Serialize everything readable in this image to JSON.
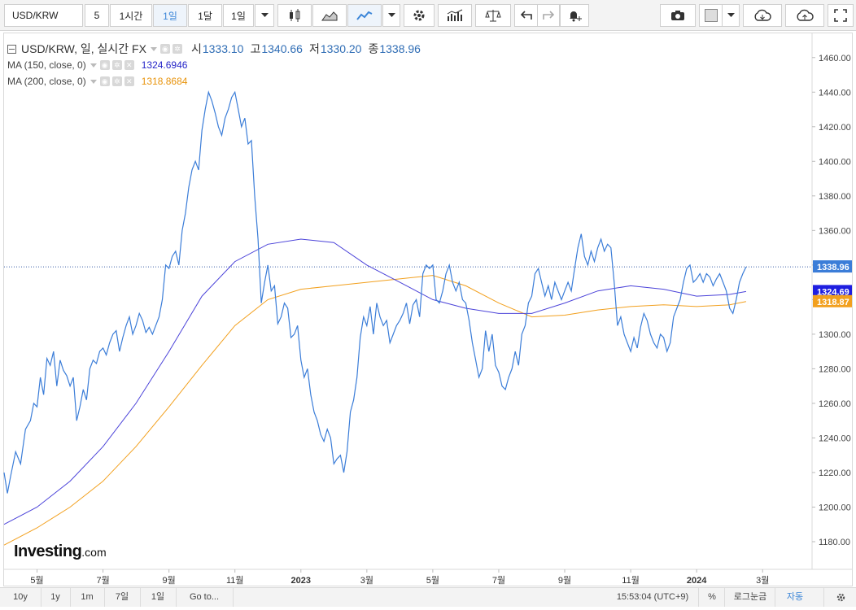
{
  "toolbar": {
    "symbol": "USD/KRW",
    "items": [
      "5",
      "1시간",
      "1일",
      "1달",
      "1일"
    ],
    "active_item": "1일"
  },
  "legend": {
    "title": "USD/KRW, 일, 실시간 FX",
    "open_label": "시",
    "open": "1333.10",
    "high_label": "고",
    "high": "1340.66",
    "low_label": "저",
    "low": "1330.20",
    "close_label": "종",
    "close": "1338.96",
    "ma150_label": "MA (150, close, 0)",
    "ma150_value": "1324.6946",
    "ma200_label": "MA (200, close, 0)",
    "ma200_value": "1318.8684"
  },
  "logo": {
    "name": "Investing",
    "suffix": ".com"
  },
  "bottom": {
    "ranges": [
      "10y",
      "1y",
      "1m",
      "7일",
      "1일",
      "Go to..."
    ],
    "time": "15:53:04 (UTC+9)",
    "percent": "%",
    "log": "로그눈금",
    "auto": "자동"
  },
  "colors": {
    "price": "#3b7dd8",
    "ma150": "#4b43d9",
    "ma200": "#f2a01e",
    "last_price_tag": "#3b7dd8",
    "ma150_tag": "#1e1ee0",
    "ma200_tag": "#f2a01e"
  },
  "chart_data": {
    "type": "line",
    "title": "USD/KRW, 일, 실시간 FX",
    "y_ticks": [
      1180,
      1200,
      1220,
      1240,
      1260,
      1280,
      1300,
      1320,
      1340,
      1360,
      1380,
      1400,
      1420,
      1440,
      1460
    ],
    "ylim": [
      1164,
      1474
    ],
    "x_ticks": [
      "5월",
      "7월",
      "9월",
      "11월",
      "2023",
      "3월",
      "5월",
      "7월",
      "9월",
      "11월",
      "2024",
      "3월"
    ],
    "x_tick_index": [
      1,
      3,
      5,
      7,
      9,
      11,
      13,
      15,
      17,
      19,
      21,
      23
    ],
    "x_range": [
      0,
      24.5
    ],
    "price_tags": [
      {
        "label": "1338.96",
        "value": 1338.96,
        "color": "#3b7dd8"
      },
      {
        "label": "1324.69",
        "value": 1324.69,
        "color": "#1e1ee0"
      },
      {
        "label": "1318.87",
        "value": 1318.87,
        "color": "#f2a01e"
      }
    ],
    "last_price_line": 1338.96,
    "series": [
      {
        "name": "USD/KRW",
        "color": "#3b7dd8",
        "points": [
          [
            0.0,
            1220
          ],
          [
            0.1,
            1208
          ],
          [
            0.2,
            1218
          ],
          [
            0.35,
            1232
          ],
          [
            0.5,
            1225
          ],
          [
            0.65,
            1245
          ],
          [
            0.8,
            1250
          ],
          [
            0.9,
            1260
          ],
          [
            1.0,
            1258
          ],
          [
            1.1,
            1275
          ],
          [
            1.2,
            1265
          ],
          [
            1.3,
            1286
          ],
          [
            1.4,
            1282
          ],
          [
            1.5,
            1290
          ],
          [
            1.6,
            1270
          ],
          [
            1.7,
            1285
          ],
          [
            1.8,
            1279
          ],
          [
            1.9,
            1276
          ],
          [
            2.0,
            1270
          ],
          [
            2.1,
            1275
          ],
          [
            2.2,
            1250
          ],
          [
            2.3,
            1258
          ],
          [
            2.4,
            1268
          ],
          [
            2.5,
            1262
          ],
          [
            2.6,
            1280
          ],
          [
            2.7,
            1285
          ],
          [
            2.8,
            1283
          ],
          [
            2.9,
            1290
          ],
          [
            3.0,
            1292
          ],
          [
            3.1,
            1288
          ],
          [
            3.2,
            1295
          ],
          [
            3.3,
            1300
          ],
          [
            3.4,
            1302
          ],
          [
            3.5,
            1290
          ],
          [
            3.6,
            1298
          ],
          [
            3.7,
            1305
          ],
          [
            3.8,
            1310
          ],
          [
            3.9,
            1300
          ],
          [
            4.0,
            1305
          ],
          [
            4.1,
            1312
          ],
          [
            4.2,
            1308
          ],
          [
            4.3,
            1301
          ],
          [
            4.4,
            1304
          ],
          [
            4.5,
            1300
          ],
          [
            4.6,
            1305
          ],
          [
            4.7,
            1310
          ],
          [
            4.8,
            1320
          ],
          [
            4.9,
            1340
          ],
          [
            5.0,
            1338
          ],
          [
            5.1,
            1345
          ],
          [
            5.2,
            1348
          ],
          [
            5.3,
            1340
          ],
          [
            5.4,
            1360
          ],
          [
            5.5,
            1370
          ],
          [
            5.6,
            1385
          ],
          [
            5.7,
            1395
          ],
          [
            5.8,
            1400
          ],
          [
            5.9,
            1395
          ],
          [
            6.0,
            1418
          ],
          [
            6.1,
            1430
          ],
          [
            6.2,
            1440
          ],
          [
            6.3,
            1435
          ],
          [
            6.4,
            1428
          ],
          [
            6.5,
            1420
          ],
          [
            6.6,
            1415
          ],
          [
            6.7,
            1425
          ],
          [
            6.8,
            1430
          ],
          [
            6.9,
            1437
          ],
          [
            7.0,
            1440
          ],
          [
            7.1,
            1430
          ],
          [
            7.2,
            1420
          ],
          [
            7.3,
            1425
          ],
          [
            7.4,
            1410
          ],
          [
            7.5,
            1412
          ],
          [
            7.6,
            1380
          ],
          [
            7.7,
            1355
          ],
          [
            7.8,
            1318
          ],
          [
            7.9,
            1330
          ],
          [
            8.0,
            1340
          ],
          [
            8.1,
            1325
          ],
          [
            8.2,
            1328
          ],
          [
            8.3,
            1306
          ],
          [
            8.4,
            1310
          ],
          [
            8.5,
            1318
          ],
          [
            8.6,
            1315
          ],
          [
            8.7,
            1298
          ],
          [
            8.8,
            1300
          ],
          [
            8.9,
            1305
          ],
          [
            9.0,
            1285
          ],
          [
            9.1,
            1275
          ],
          [
            9.2,
            1280
          ],
          [
            9.3,
            1265
          ],
          [
            9.4,
            1255
          ],
          [
            9.5,
            1250
          ],
          [
            9.6,
            1242
          ],
          [
            9.7,
            1238
          ],
          [
            9.8,
            1245
          ],
          [
            9.9,
            1240
          ],
          [
            10.0,
            1225
          ],
          [
            10.1,
            1228
          ],
          [
            10.2,
            1230
          ],
          [
            10.3,
            1220
          ],
          [
            10.4,
            1232
          ],
          [
            10.5,
            1255
          ],
          [
            10.6,
            1262
          ],
          [
            10.7,
            1275
          ],
          [
            10.8,
            1298
          ],
          [
            10.9,
            1310
          ],
          [
            11.0,
            1305
          ],
          [
            11.1,
            1316
          ],
          [
            11.2,
            1300
          ],
          [
            11.3,
            1318
          ],
          [
            11.4,
            1310
          ],
          [
            11.5,
            1305
          ],
          [
            11.6,
            1308
          ],
          [
            11.7,
            1295
          ],
          [
            11.8,
            1300
          ],
          [
            11.9,
            1305
          ],
          [
            12.0,
            1308
          ],
          [
            12.1,
            1312
          ],
          [
            12.2,
            1318
          ],
          [
            12.3,
            1306
          ],
          [
            12.4,
            1317
          ],
          [
            12.5,
            1320
          ],
          [
            12.6,
            1310
          ],
          [
            12.7,
            1335
          ],
          [
            12.8,
            1340
          ],
          [
            12.9,
            1338
          ],
          [
            13.0,
            1340
          ],
          [
            13.1,
            1320
          ],
          [
            13.2,
            1318
          ],
          [
            13.3,
            1325
          ],
          [
            13.4,
            1335
          ],
          [
            13.5,
            1340
          ],
          [
            13.6,
            1330
          ],
          [
            13.7,
            1325
          ],
          [
            13.8,
            1330
          ],
          [
            13.9,
            1320
          ],
          [
            14.0,
            1318
          ],
          [
            14.1,
            1308
          ],
          [
            14.2,
            1295
          ],
          [
            14.3,
            1285
          ],
          [
            14.4,
            1275
          ],
          [
            14.5,
            1280
          ],
          [
            14.6,
            1302
          ],
          [
            14.7,
            1290
          ],
          [
            14.8,
            1300
          ],
          [
            14.9,
            1282
          ],
          [
            15.0,
            1278
          ],
          [
            15.1,
            1270
          ],
          [
            15.2,
            1268
          ],
          [
            15.3,
            1275
          ],
          [
            15.4,
            1280
          ],
          [
            15.5,
            1290
          ],
          [
            15.6,
            1282
          ],
          [
            15.7,
            1300
          ],
          [
            15.8,
            1305
          ],
          [
            15.9,
            1318
          ],
          [
            16.0,
            1322
          ],
          [
            16.1,
            1335
          ],
          [
            16.2,
            1338
          ],
          [
            16.3,
            1330
          ],
          [
            16.4,
            1322
          ],
          [
            16.5,
            1328
          ],
          [
            16.6,
            1320
          ],
          [
            16.7,
            1330
          ],
          [
            16.8,
            1325
          ],
          [
            16.9,
            1320
          ],
          [
            17.0,
            1325
          ],
          [
            17.1,
            1330
          ],
          [
            17.2,
            1325
          ],
          [
            17.3,
            1338
          ],
          [
            17.4,
            1350
          ],
          [
            17.5,
            1358
          ],
          [
            17.6,
            1345
          ],
          [
            17.7,
            1340
          ],
          [
            17.8,
            1348
          ],
          [
            17.9,
            1342
          ],
          [
            18.0,
            1350
          ],
          [
            18.1,
            1355
          ],
          [
            18.2,
            1348
          ],
          [
            18.3,
            1352
          ],
          [
            18.4,
            1350
          ],
          [
            18.5,
            1330
          ],
          [
            18.6,
            1305
          ],
          [
            18.7,
            1310
          ],
          [
            18.8,
            1300
          ],
          [
            18.9,
            1295
          ],
          [
            19.0,
            1290
          ],
          [
            19.1,
            1298
          ],
          [
            19.2,
            1292
          ],
          [
            19.3,
            1304
          ],
          [
            19.4,
            1312
          ],
          [
            19.5,
            1308
          ],
          [
            19.6,
            1300
          ],
          [
            19.7,
            1295
          ],
          [
            19.8,
            1292
          ],
          [
            19.9,
            1300
          ],
          [
            20.0,
            1298
          ],
          [
            20.1,
            1290
          ],
          [
            20.2,
            1295
          ],
          [
            20.3,
            1310
          ],
          [
            20.4,
            1315
          ],
          [
            20.5,
            1320
          ],
          [
            20.6,
            1330
          ],
          [
            20.7,
            1338
          ],
          [
            20.8,
            1340
          ],
          [
            20.9,
            1330
          ],
          [
            21.0,
            1332
          ],
          [
            21.1,
            1335
          ],
          [
            21.2,
            1330
          ],
          [
            21.3,
            1335
          ],
          [
            21.4,
            1333
          ],
          [
            21.5,
            1328
          ],
          [
            21.6,
            1332
          ],
          [
            21.7,
            1335
          ],
          [
            21.8,
            1330
          ],
          [
            21.9,
            1325
          ],
          [
            22.0,
            1315
          ],
          [
            22.1,
            1312
          ],
          [
            22.2,
            1320
          ],
          [
            22.3,
            1330
          ],
          [
            22.4,
            1335
          ],
          [
            22.5,
            1338.96
          ]
        ]
      },
      {
        "name": "MA (150, close, 0)",
        "color": "#4b43d9",
        "points": [
          [
            0,
            1190
          ],
          [
            1,
            1200
          ],
          [
            2,
            1215
          ],
          [
            3,
            1235
          ],
          [
            4,
            1260
          ],
          [
            5,
            1290
          ],
          [
            6,
            1322
          ],
          [
            7,
            1342
          ],
          [
            8,
            1352
          ],
          [
            9,
            1355
          ],
          [
            10,
            1353
          ],
          [
            11,
            1340
          ],
          [
            12,
            1330
          ],
          [
            13,
            1320
          ],
          [
            14,
            1315
          ],
          [
            15,
            1312
          ],
          [
            16,
            1312
          ],
          [
            17,
            1318
          ],
          [
            18,
            1325
          ],
          [
            19,
            1328
          ],
          [
            20,
            1326
          ],
          [
            21,
            1322
          ],
          [
            22,
            1323
          ],
          [
            22.5,
            1324.69
          ]
        ]
      },
      {
        "name": "MA (200, close, 0)",
        "color": "#f2a01e",
        "points": [
          [
            0,
            1178
          ],
          [
            1,
            1188
          ],
          [
            2,
            1200
          ],
          [
            3,
            1215
          ],
          [
            4,
            1235
          ],
          [
            5,
            1258
          ],
          [
            6,
            1282
          ],
          [
            7,
            1305
          ],
          [
            8,
            1320
          ],
          [
            9,
            1326
          ],
          [
            10,
            1328
          ],
          [
            11,
            1330
          ],
          [
            12,
            1332
          ],
          [
            13,
            1334
          ],
          [
            14,
            1328
          ],
          [
            15,
            1318
          ],
          [
            16,
            1310
          ],
          [
            17,
            1311
          ],
          [
            18,
            1314
          ],
          [
            19,
            1316
          ],
          [
            20,
            1317
          ],
          [
            21,
            1316
          ],
          [
            22,
            1317
          ],
          [
            22.5,
            1318.87
          ]
        ]
      }
    ]
  }
}
